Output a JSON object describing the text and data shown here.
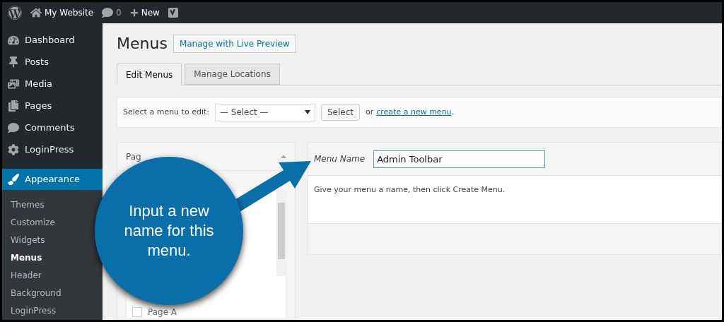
{
  "admin_bar": {
    "site_name": "My Website",
    "comments_count": "0",
    "new_label": "New"
  },
  "sidebar": {
    "items": [
      {
        "label": "Dashboard",
        "selected": false
      },
      {
        "label": "Posts",
        "selected": false
      },
      {
        "label": "Media",
        "selected": false
      },
      {
        "label": "Pages",
        "selected": false
      },
      {
        "label": "Comments",
        "selected": false
      },
      {
        "label": "LoginPress",
        "selected": false
      },
      {
        "label": "Appearance",
        "selected": true
      }
    ],
    "submenu": [
      {
        "label": "Themes",
        "selected": false
      },
      {
        "label": "Customize",
        "selected": false
      },
      {
        "label": "Widgets",
        "selected": false
      },
      {
        "label": "Menus",
        "selected": true
      },
      {
        "label": "Header",
        "selected": false
      },
      {
        "label": "Background",
        "selected": false
      },
      {
        "label": "LoginPress",
        "selected": false
      }
    ]
  },
  "page": {
    "title": "Menus",
    "live_preview_button": "Manage with Live Preview",
    "tabs": [
      {
        "label": "Edit Menus",
        "selected": true
      },
      {
        "label": "Manage Locations",
        "selected": false
      }
    ],
    "select_bar": {
      "label": "Select a menu to edit:",
      "dropdown_value": "— Select —",
      "button": "Select",
      "or_text": "or",
      "link": "create a new menu",
      "end": "."
    },
    "left_panel": {
      "heading": "Pag",
      "items": [
        {
          "label": "Page A",
          "checked": false
        }
      ]
    },
    "menu_panel": {
      "name_label": "Menu Name",
      "name_value": "Admin Toolbar",
      "hint": "Give your menu a name, then click Create Menu."
    }
  },
  "callout": {
    "text": "Input a new name for this menu."
  }
}
